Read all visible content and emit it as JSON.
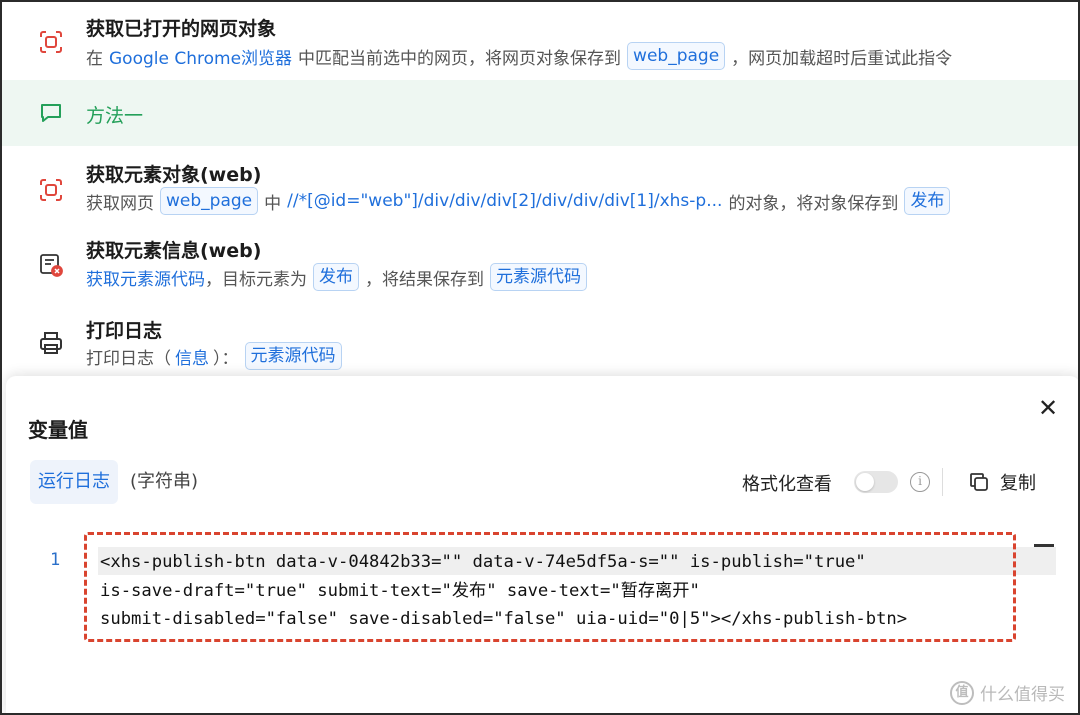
{
  "steps": [
    {
      "title": "获取已打开的网页对象",
      "desc_prefix": "在",
      "browser": "Google Chrome浏览器",
      "desc_mid": "中匹配当前选中的网页，将网页对象保存到",
      "var": "web_page",
      "desc_suffix": "，网页加载超时后重试此指令",
      "icon": "web-capture-icon"
    },
    {
      "title": "获取元素对象(web)",
      "desc_prefix": "获取网页",
      "var_in": "web_page",
      "desc_mid": "中",
      "xpath": "//*[@id=\"web\"]/div/div/div[2]/div/div/div[1]/xhs-p...",
      "desc_mid2": "的对象，将对象保存到",
      "var_out": "发布",
      "icon": "web-capture-icon"
    },
    {
      "title": "获取元素信息(web)",
      "link": "获取元素源代码",
      "desc_mid": "，目标元素为",
      "target": "发布",
      "desc_mid2": "，将结果保存到",
      "var_out": "元素源代码",
      "icon": "element-info-icon"
    },
    {
      "title": "打印日志",
      "desc_prefix": "打印日志（",
      "level": "信息",
      "desc_mid": "）：",
      "var": "元素源代码",
      "icon": "printer-icon"
    }
  ],
  "comment": {
    "text": "方法一",
    "icon": "comment-icon"
  },
  "dialog": {
    "title": "变量值",
    "tab_active": "运行日志",
    "value_type": "(字符串)",
    "format_label": "格式化查看",
    "format_enabled": false,
    "copy_label": "复制",
    "line_number": "1",
    "code_lines": [
      "<xhs-publish-btn data-v-04842b33=\"\" data-v-74e5df5a-s=\"\" is-publish=\"true\"",
      "is-save-draft=\"true\" submit-text=\"发布\" save-text=\"暂存离开\"",
      "submit-disabled=\"false\" save-disabled=\"false\" uia-uid=\"0|5\"></xhs-publish-btn>"
    ]
  },
  "watermark": {
    "logo": "值",
    "text": "什么值得买"
  },
  "colors": {
    "accent": "#1f6fdb",
    "comment_green": "#24a05a",
    "comment_bg": "#eef7f2",
    "icon_red": "#e0473d",
    "highlight_dash": "#d9442f"
  }
}
